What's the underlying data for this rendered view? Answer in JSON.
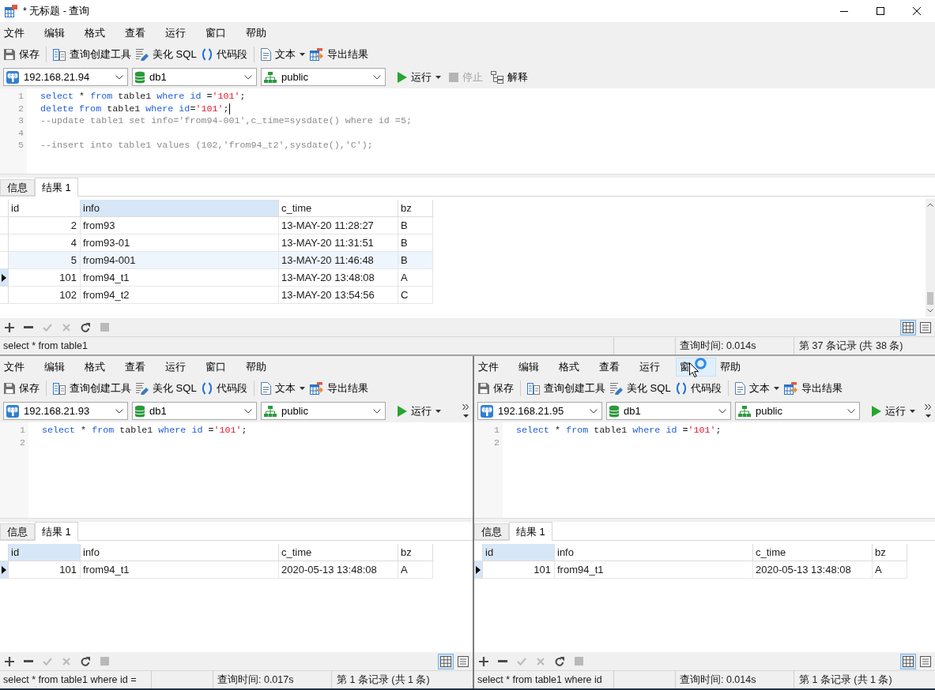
{
  "window": {
    "title": "* 无标题 - 查询"
  },
  "panes": [
    {
      "menu": [
        {
          "label": "文件",
          "hovered": false
        },
        {
          "label": "编辑",
          "hovered": false
        },
        {
          "label": "格式",
          "hovered": false
        },
        {
          "label": "查看",
          "hovered": false
        },
        {
          "label": "运行",
          "hovered": false
        },
        {
          "label": "窗口",
          "hovered": false
        },
        {
          "label": "帮助",
          "hovered": false
        }
      ],
      "toolbar": [
        [
          {
            "kind": "save",
            "label": "保存",
            "dropdown": false
          }
        ],
        [
          {
            "kind": "query_builder",
            "label": "查询创建工具",
            "dropdown": false
          },
          {
            "kind": "beautify",
            "label": "美化 SQL",
            "dropdown": false
          },
          {
            "kind": "snippet",
            "label": "代码段",
            "dropdown": false
          }
        ],
        [
          {
            "kind": "text",
            "label": "文本",
            "dropdown": true
          },
          {
            "kind": "export",
            "label": "导出结果",
            "dropdown": false
          }
        ]
      ],
      "connection": {
        "server": "192.168.21.94",
        "database": "db1",
        "schema": "public"
      },
      "actions": [
        {
          "kind": "run",
          "label": "运行",
          "dropdown": true,
          "disabled": false
        },
        {
          "kind": "stop",
          "label": "停止",
          "dropdown": false,
          "disabled": true
        },
        {
          "kind": "explain",
          "label": "解释",
          "dropdown": false,
          "disabled": false
        }
      ],
      "code": [
        {
          "number": "1",
          "caret": false,
          "tokens": [
            {
              "kind": "keyword",
              "text": "select"
            },
            {
              "kind": "plain",
              "text": " * "
            },
            {
              "kind": "keyword",
              "text": "from"
            },
            {
              "kind": "plain",
              "text": " table1 "
            },
            {
              "kind": "keyword",
              "text": "where id"
            },
            {
              "kind": "plain",
              "text": " ="
            },
            {
              "kind": "string",
              "text": "'101'"
            },
            {
              "kind": "plain",
              "text": ";"
            }
          ]
        },
        {
          "number": "2",
          "caret": true,
          "tokens": [
            {
              "kind": "keyword",
              "text": "delete from"
            },
            {
              "kind": "plain",
              "text": " table1 "
            },
            {
              "kind": "keyword",
              "text": "where id"
            },
            {
              "kind": "plain",
              "text": "="
            },
            {
              "kind": "string",
              "text": "'101'"
            },
            {
              "kind": "plain",
              "text": ";"
            }
          ]
        },
        {
          "number": "3",
          "caret": false,
          "tokens": [
            {
              "kind": "comment",
              "text": "--update table1 set info='from94-001',c_time=sysdate() where id =5;"
            }
          ]
        },
        {
          "number": "4",
          "caret": false
        },
        {
          "number": "5",
          "caret": false,
          "tokens": [
            {
              "kind": "comment",
              "text": "--insert into table1 values (102,'from94_t2',sysdate(),'C');"
            }
          ]
        }
      ],
      "result_tabs": [
        {
          "label": "信息",
          "selected": false
        },
        {
          "label": "结果 1",
          "selected": true
        }
      ],
      "table": {
        "scrollable": true,
        "columns": [
          {
            "label": "id",
            "selected": false
          },
          {
            "label": "info",
            "selected": true
          },
          {
            "label": "c_time",
            "selected": false
          },
          {
            "label": "bz",
            "selected": false
          }
        ],
        "rows": [
          {
            "cells": [
              "2",
              "from93",
              "13-MAY-20 11:28:27",
              "B"
            ],
            "current": false,
            "highlighted": false
          },
          {
            "cells": [
              "4",
              "from93-01",
              "13-MAY-20 11:31:51",
              "B"
            ],
            "current": false,
            "highlighted": false
          },
          {
            "cells": [
              "5",
              "from94-001",
              "13-MAY-20 11:46:48",
              "B"
            ],
            "current": false,
            "highlighted": true
          },
          {
            "cells": [
              "101",
              "from94_t1",
              "13-MAY-20 13:48:08",
              "A"
            ],
            "current": true,
            "highlighted": false
          },
          {
            "cells": [
              "102",
              "from94_t2",
              "13-MAY-20 13:54:56",
              "C"
            ],
            "current": false,
            "highlighted": false
          }
        ]
      },
      "grid_tools": [
        {
          "kind": "add",
          "disabled": false
        },
        {
          "kind": "remove",
          "disabled": false
        },
        {
          "kind": "apply",
          "disabled": true
        },
        {
          "kind": "discard",
          "disabled": true
        },
        {
          "kind": "refresh",
          "disabled": false
        },
        {
          "kind": "stop",
          "disabled": true
        }
      ],
      "views": [
        {
          "kind": "grid",
          "selected": true
        },
        {
          "kind": "form",
          "selected": false
        }
      ],
      "status": {
        "sql": "select * from table1",
        "time": "查询时间: 0.014s",
        "records": "第 37 条记录 (共 38 条)"
      }
    },
    {
      "menu": [
        {
          "label": "文件",
          "hovered": false
        },
        {
          "label": "编辑",
          "hovered": false
        },
        {
          "label": "格式",
          "hovered": false
        },
        {
          "label": "查看",
          "hovered": false
        },
        {
          "label": "运行",
          "hovered": false
        },
        {
          "label": "窗口",
          "hovered": false
        },
        {
          "label": "帮助",
          "hovered": false
        }
      ],
      "toolbar": [
        [
          {
            "kind": "save",
            "label": "保存",
            "dropdown": false
          }
        ],
        [
          {
            "kind": "query_builder",
            "label": "查询创建工具",
            "dropdown": false
          },
          {
            "kind": "beautify",
            "label": "美化 SQL",
            "dropdown": false
          },
          {
            "kind": "snippet",
            "label": "代码段",
            "dropdown": false
          }
        ],
        [
          {
            "kind": "text",
            "label": "文本",
            "dropdown": true
          },
          {
            "kind": "export",
            "label": "导出结果",
            "dropdown": false
          }
        ]
      ],
      "connection": {
        "server": "192.168.21.93",
        "database": "db1",
        "schema": "public"
      },
      "actions": [
        {
          "kind": "run",
          "label": "运行",
          "dropdown": true,
          "disabled": false
        }
      ],
      "overflow": true,
      "code": [
        {
          "number": "1",
          "caret": false,
          "tokens": [
            {
              "kind": "keyword",
              "text": "select"
            },
            {
              "kind": "plain",
              "text": " * "
            },
            {
              "kind": "keyword",
              "text": "from"
            },
            {
              "kind": "plain",
              "text": " table1 "
            },
            {
              "kind": "keyword",
              "text": "where id"
            },
            {
              "kind": "plain",
              "text": " ="
            },
            {
              "kind": "string",
              "text": "'101'"
            },
            {
              "kind": "plain",
              "text": ";"
            }
          ]
        },
        {
          "number": "2",
          "caret": false
        }
      ],
      "result_tabs": [
        {
          "label": "信息",
          "selected": false
        },
        {
          "label": "结果 1",
          "selected": true
        }
      ],
      "table": {
        "columns": [
          {
            "label": "id",
            "selected": true
          },
          {
            "label": "info",
            "selected": false
          },
          {
            "label": "c_time",
            "selected": false
          },
          {
            "label": "bz",
            "selected": false
          }
        ],
        "rows": [
          {
            "cells": [
              "101",
              "from94_t1",
              "2020-05-13 13:48:08",
              "A"
            ],
            "current": true,
            "highlighted": false
          }
        ]
      },
      "grid_tools": [
        {
          "kind": "add",
          "disabled": false
        },
        {
          "kind": "remove",
          "disabled": false
        },
        {
          "kind": "apply",
          "disabled": true
        },
        {
          "kind": "discard",
          "disabled": true
        },
        {
          "kind": "refresh",
          "disabled": false
        },
        {
          "kind": "stop",
          "disabled": true
        }
      ],
      "views": [
        {
          "kind": "grid",
          "selected": true
        },
        {
          "kind": "form",
          "selected": false
        }
      ],
      "status": {
        "sql": "select * from table1 where id =",
        "time": "查询时间: 0.017s",
        "records": "第 1 条记录 (共 1 条)"
      }
    },
    {
      "menu": [
        {
          "label": "文件",
          "hovered": false
        },
        {
          "label": "编辑",
          "hovered": false
        },
        {
          "label": "格式",
          "hovered": false
        },
        {
          "label": "查看",
          "hovered": false
        },
        {
          "label": "运行",
          "hovered": false
        },
        {
          "label": "窗",
          "hovered": true
        },
        {
          "label": "帮助",
          "hovered": false
        }
      ],
      "busy_cursor": true,
      "toolbar": [
        [
          {
            "kind": "save",
            "label": "保存",
            "dropdown": false
          }
        ],
        [
          {
            "kind": "query_builder",
            "label": "查询创建工具",
            "dropdown": false
          },
          {
            "kind": "beautify",
            "label": "美化 SQL",
            "dropdown": false
          },
          {
            "kind": "snippet",
            "label": "代码段",
            "dropdown": false
          }
        ],
        [
          {
            "kind": "text",
            "label": "文本",
            "dropdown": true
          },
          {
            "kind": "export",
            "label": "导出结果",
            "dropdown": false
          }
        ]
      ],
      "connection": {
        "server": "192.168.21.95",
        "database": "db1",
        "schema": "public"
      },
      "actions": [
        {
          "kind": "run",
          "label": "运行",
          "dropdown": true,
          "disabled": false
        }
      ],
      "overflow": true,
      "code": [
        {
          "number": "1",
          "caret": false,
          "tokens": [
            {
              "kind": "keyword",
              "text": "select"
            },
            {
              "kind": "plain",
              "text": " * "
            },
            {
              "kind": "keyword",
              "text": "from"
            },
            {
              "kind": "plain",
              "text": " table1 "
            },
            {
              "kind": "keyword",
              "text": "where id"
            },
            {
              "kind": "plain",
              "text": " ="
            },
            {
              "kind": "string",
              "text": "'101'"
            },
            {
              "kind": "plain",
              "text": ";"
            }
          ]
        },
        {
          "number": "2",
          "caret": false
        }
      ],
      "result_tabs": [
        {
          "label": "信息",
          "selected": false
        },
        {
          "label": "结果 1",
          "selected": true
        }
      ],
      "table": {
        "columns": [
          {
            "label": "id",
            "selected": true
          },
          {
            "label": "info",
            "selected": false
          },
          {
            "label": "c_time",
            "selected": false
          },
          {
            "label": "bz",
            "selected": false
          }
        ],
        "rows": [
          {
            "cells": [
              "101",
              "from94_t1",
              "2020-05-13 13:48:08",
              "A"
            ],
            "current": true,
            "highlighted": false
          }
        ]
      },
      "grid_tools": [
        {
          "kind": "add",
          "disabled": false
        },
        {
          "kind": "remove",
          "disabled": false
        },
        {
          "kind": "apply",
          "disabled": true
        },
        {
          "kind": "discard",
          "disabled": true
        },
        {
          "kind": "refresh",
          "disabled": false
        },
        {
          "kind": "stop",
          "disabled": true
        }
      ],
      "views": [
        {
          "kind": "grid",
          "selected": true
        },
        {
          "kind": "form",
          "selected": false
        }
      ],
      "status": {
        "sql": "select * from table1 where id",
        "time": "查询时间: 0.014s",
        "records": "第 1 条记录 (共 1 条)"
      }
    }
  ]
}
